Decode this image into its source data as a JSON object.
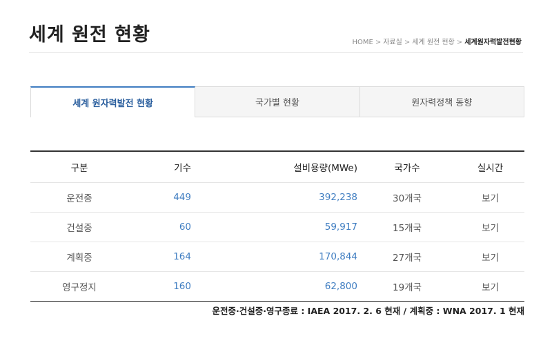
{
  "page": {
    "title": "세계 원전 현황"
  },
  "breadcrumb": {
    "items": [
      "HOME",
      "자료실",
      "세계 원전 현황"
    ],
    "current": "세계원자력발전현황",
    "separator": ">"
  },
  "tabs": [
    {
      "label": "세계 원자력발전 현황",
      "active": true
    },
    {
      "label": "국가별 현황",
      "active": false
    },
    {
      "label": "원자력정책 동향",
      "active": false
    }
  ],
  "table": {
    "headers": {
      "category": "구분",
      "units": "기수",
      "capacity": "설비용량(MWe)",
      "nations": "국가수",
      "realtime": "실시간"
    },
    "rows": [
      {
        "category": "운전중",
        "units": "449",
        "capacity": "392,238",
        "nations": "30개국",
        "realtime": "보기"
      },
      {
        "category": "건설중",
        "units": "60",
        "capacity": "59,917",
        "nations": "15개국",
        "realtime": "보기"
      },
      {
        "category": "계획중",
        "units": "164",
        "capacity": "170,844",
        "nations": "27개국",
        "realtime": "보기"
      },
      {
        "category": "영구정지",
        "units": "160",
        "capacity": "62,800",
        "nations": "19개국",
        "realtime": "보기"
      }
    ]
  },
  "footnote": "운전중·건설중·영구종료 : IAEA 2017. 2. 6 현재 / 계획중 : WNA 2017. 1 현재",
  "colors": {
    "accent": "#3f7dc1",
    "active_tab_text": "#2b5f9e",
    "table_rule": "#333333"
  }
}
